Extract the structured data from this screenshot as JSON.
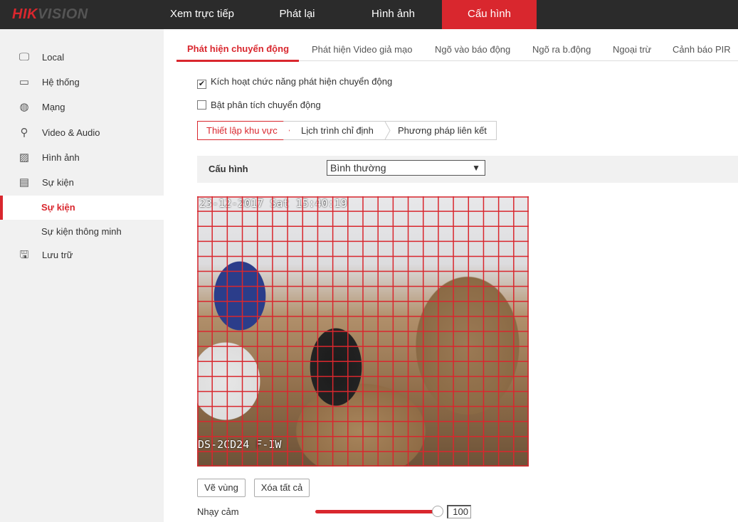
{
  "brand": {
    "logo_red": "HIK",
    "logo_gray": "VISION"
  },
  "topnav": [
    {
      "label": "Xem trực tiếp"
    },
    {
      "label": "Phát lại"
    },
    {
      "label": "Hình ảnh"
    },
    {
      "label": "Cấu hình",
      "active": true
    }
  ],
  "sidebar": {
    "items": [
      {
        "label": "Local",
        "icon": "monitor-icon"
      },
      {
        "label": "Hệ thống",
        "icon": "window-icon"
      },
      {
        "label": "Mạng",
        "icon": "globe-icon"
      },
      {
        "label": "Video & Audio",
        "icon": "mic-camera-icon"
      },
      {
        "label": "Hình ảnh",
        "icon": "image-icon"
      },
      {
        "label": "Sự kiện",
        "icon": "calendar-icon"
      },
      {
        "label": "Sự kiện",
        "active": true
      },
      {
        "label": "Sự kiện thông minh"
      },
      {
        "label": "Lưu trữ",
        "icon": "save-icon"
      }
    ]
  },
  "tabs": [
    "Phát hiện chuyển động",
    "Phát hiện Video giả mạo",
    "Ngõ vào báo động",
    "Ngõ ra b.động",
    "Ngoại trừ",
    "Cảnh báo PIR"
  ],
  "options": {
    "enable_motion": {
      "label": "Kích hoạt chức năng phát hiện chuyển động",
      "checked": true
    },
    "enable_analysis": {
      "label": "Bật phân tích chuyển động",
      "checked": false
    }
  },
  "steps": [
    "Thiết lập khu vực",
    "Lịch trình chỉ định",
    "Phương pháp liên kết"
  ],
  "config": {
    "label": "Cấu hình",
    "value": "Bình thường"
  },
  "video": {
    "osd_time": "23-12-2017 Sat 15:40:19",
    "osd_model": "DS-2CD24  F-IW",
    "grid_color": "#d9272e"
  },
  "buttons": {
    "draw": "Vẽ vùng",
    "clear": "Xóa tất cả"
  },
  "sensitivity": {
    "label": "Nhạy cảm",
    "value": "100",
    "percent": 100
  },
  "colors": {
    "accent": "#d9272e",
    "topbar": "#2b2b2b"
  }
}
